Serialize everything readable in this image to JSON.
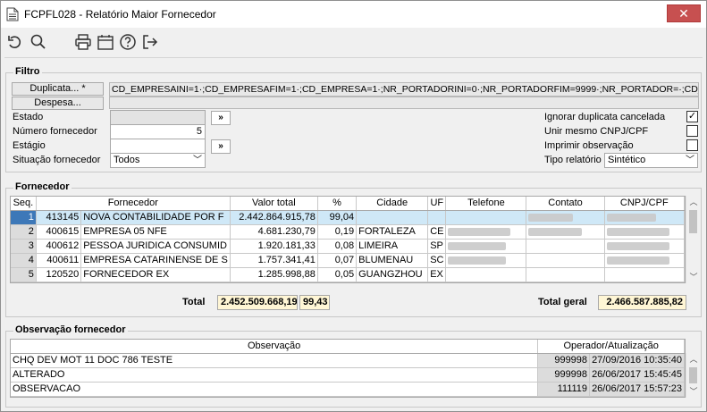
{
  "window": {
    "title": "FCPFL028 - Relatório Maior Fornecedor",
    "close": "✕"
  },
  "toolbar": {
    "icons": [
      "undo-icon",
      "search-icon",
      "print-icon",
      "calendar-icon",
      "help-icon",
      "exit-icon"
    ]
  },
  "filtro": {
    "label": "Filtro",
    "duplicata_button": "Duplicata... *",
    "despesa_button": "Despesa...",
    "filter_text": "CD_EMPRESAINI=1·;CD_EMPRESAFIM=1·;CD_EMPRESA=1·;NR_PORTADORINI=0·;NR_PORTADORFIM=9999·;NR_PORTADOR=·;CD_FOR",
    "estado_label": "Estado",
    "estado_value": "",
    "numero_label": "Número fornecedor",
    "numero_value": "5",
    "estagio_label": "Estágio",
    "estagio_value": "",
    "situacao_label": "Situação fornecedor",
    "situacao_value": "Todos",
    "lookup_button": "»",
    "ignorar_label": "Ignorar duplicata cancelada",
    "ignorar_checked": "✓",
    "unir_label": "Unir mesmo CNPJ/CPF",
    "imprimir_label": "Imprimir observação",
    "tipo_label": "Tipo relatório",
    "tipo_value": "Sintético"
  },
  "fornecedor": {
    "label": "Fornecedor",
    "columns": [
      "Seq.",
      "Fornecedor",
      "Valor total",
      "%",
      "Cidade",
      "UF",
      "Telefone",
      "Contato",
      "CNPJ/CPF"
    ],
    "rows": [
      {
        "seq": "1",
        "codigo": "413145",
        "nome": "NOVA CONTABILIDADE POR F",
        "valor": "2.442.864.915,78",
        "pct": "99,04",
        "cidade": "",
        "uf": ""
      },
      {
        "seq": "2",
        "codigo": "400615",
        "nome": "EMPRESA 05 NFE",
        "valor": "4.681.230,79",
        "pct": "0,19",
        "cidade": "FORTALEZA",
        "uf": "CE"
      },
      {
        "seq": "3",
        "codigo": "400612",
        "nome": "PESSOA JURIDICA CONSUMID",
        "valor": "1.920.181,33",
        "pct": "0,08",
        "cidade": "LIMEIRA",
        "uf": "SP"
      },
      {
        "seq": "4",
        "codigo": "400611",
        "nome": "EMPRESA CATARINENSE DE S",
        "valor": "1.757.341,41",
        "pct": "0,07",
        "cidade": "BLUMENAU",
        "uf": "SC"
      },
      {
        "seq": "5",
        "codigo": "120520",
        "nome": "FORNECEDOR EX",
        "valor": "1.285.998,88",
        "pct": "0,05",
        "cidade": "GUANGZHOU",
        "uf": "EX"
      }
    ],
    "total_label": "Total",
    "total_valor": "2.452.509.668,19",
    "total_pct": "99,43",
    "total_geral_label": "Total geral",
    "total_geral_valor": "2.466.587.885,82"
  },
  "observacao": {
    "label": "Observação fornecedor",
    "col_obs": "Observação",
    "col_oper": "Operador/Atualização",
    "rows": [
      {
        "texto": "CHQ DEV MOT 11   DOC  786 TESTE",
        "operador": "999998",
        "data": "27/09/2016 10:35:40"
      },
      {
        "texto": "ALTERADO",
        "operador": "999998",
        "data": "26/06/2017 15:45:45"
      },
      {
        "texto": "OBSERVACAO",
        "operador": "111119",
        "data": "26/06/2017 15:57:23"
      }
    ]
  }
}
